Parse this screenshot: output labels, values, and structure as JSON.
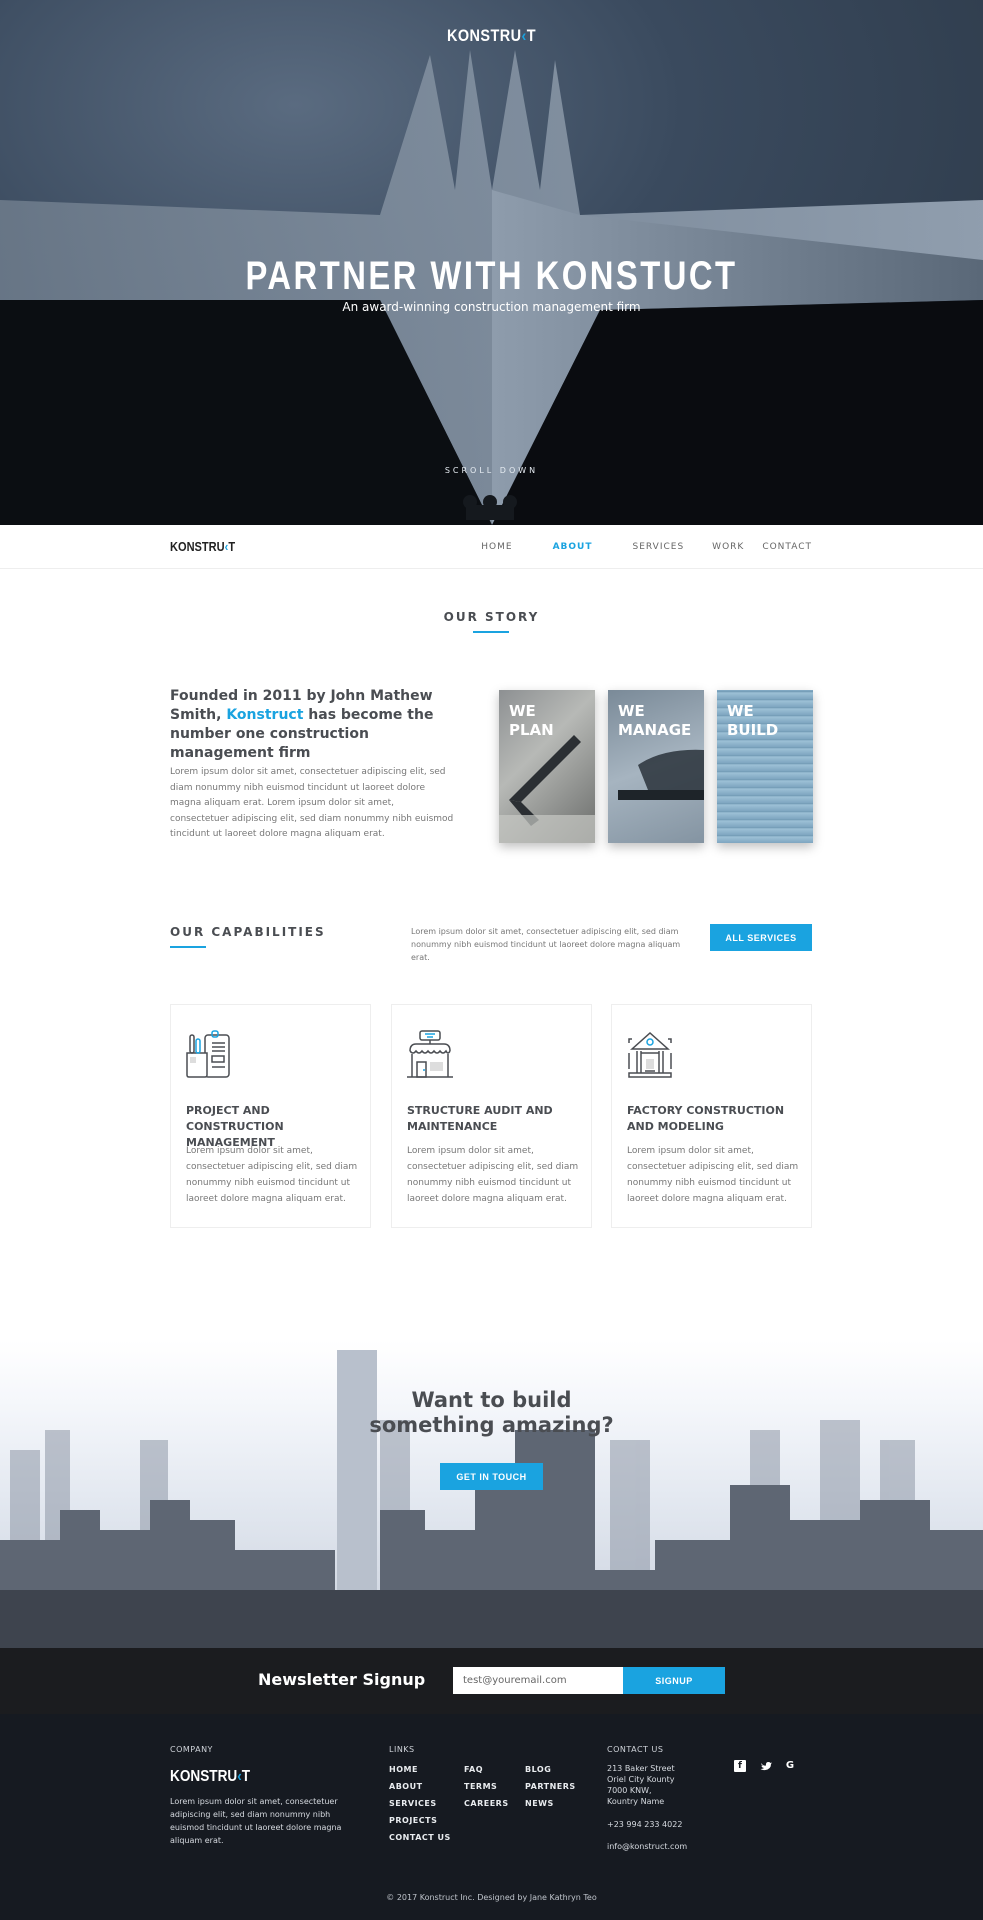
{
  "brand": {
    "logo_prefix": "KONSTRU",
    "logo_accent": "‹",
    "logo_suffix": "T",
    "accent_color": "#1aa3e0"
  },
  "hero": {
    "title": "PARTNER WITH KONSTUCT",
    "subtitle": "An award-winning construction management firm",
    "scroll_label": "SCROLL DOWN"
  },
  "nav": {
    "items": [
      {
        "label": "HOME",
        "active": false
      },
      {
        "label": "ABOUT",
        "active": true
      },
      {
        "label": "SERVICES",
        "active": false
      },
      {
        "label": "WORK",
        "active": false
      },
      {
        "label": "CONTACT",
        "active": false
      }
    ]
  },
  "story": {
    "section_title": "OUR STORY",
    "heading_part1": "Founded in 2011 by John Mathew Smith, ",
    "heading_highlight": "Konstruct",
    "heading_part2": " has become the number one construction management firm",
    "body": "Lorem ipsum dolor sit amet, consectetuer adipiscing elit, sed diam nonummy nibh euismod tincidunt ut laoreet dolore magna aliquam erat. Lorem ipsum dolor sit amet, consectetuer adipiscing elit, sed diam nonummy nibh euismod tincidunt ut laoreet dolore magna aliquam erat.",
    "tiles": [
      {
        "line1": "WE",
        "line2": "PLAN"
      },
      {
        "line1": "WE",
        "line2": "MANAGE"
      },
      {
        "line1": "WE",
        "line2": "BUILD"
      }
    ]
  },
  "capabilities": {
    "section_title": "OUR CAPABILITIES",
    "description": "Lorem ipsum dolor sit amet, consectetuer adipiscing elit, sed diam nonummy nibh euismod tincidunt ut laoreet dolore magna aliquam erat.",
    "button_label": "ALL SERVICES",
    "cards": [
      {
        "icon": "clipboard-pencils-icon",
        "title": "PROJECT AND CONSTRUCTION MANAGEMENT",
        "body": "Lorem ipsum dolor sit amet, consectetuer adipiscing elit, sed diam nonummy nibh euismod tincidunt ut laoreet dolore magna aliquam erat."
      },
      {
        "icon": "storefront-icon",
        "title": "STRUCTURE AUDIT AND MAINTENANCE",
        "body": "Lorem ipsum dolor sit amet, consectetuer adipiscing elit, sed diam nonummy nibh euismod tincidunt ut laoreet dolore magna aliquam erat."
      },
      {
        "icon": "bank-building-icon",
        "title": "FACTORY CONSTRUCTION AND MODELING",
        "body": "Lorem ipsum dolor sit amet, consectetuer adipiscing elit, sed diam nonummy nibh euismod tincidunt ut laoreet dolore magna aliquam erat."
      }
    ]
  },
  "cta": {
    "title_line1": "Want to build",
    "title_line2": "something amazing?",
    "button_label": "GET IN TOUCH"
  },
  "newsletter": {
    "label": "Newsletter Signup",
    "input_value": "test@youremail.com",
    "button_label": "SIGNUP"
  },
  "footer": {
    "company_heading": "COMPANY",
    "company_text": "Lorem ipsum dolor sit amet, consectetuer adipiscing elit, sed diam nonummy nibh euismod tincidunt ut laoreet dolore magna aliquam erat.",
    "links_heading": "LINKS",
    "links_col1": [
      "HOME",
      "ABOUT",
      "SERVICES",
      "PROJECTS",
      "CONTACT US"
    ],
    "links_col2": [
      "FAQ",
      "TERMS",
      "CAREERS"
    ],
    "links_col3": [
      "BLOG",
      "PARTNERS",
      "NEWS"
    ],
    "contact_heading": "CONTACT US",
    "address": [
      "213 Baker Street",
      "Oriel City Kounty",
      "7000 KNW,",
      "Kountry Name"
    ],
    "phone": "+23 994 233 4022",
    "email": "info@konstruct.com",
    "social": [
      {
        "name": "facebook-icon",
        "glyph": "f"
      },
      {
        "name": "twitter-icon",
        "glyph": "t"
      },
      {
        "name": "google-icon",
        "glyph": "G"
      }
    ],
    "copyright": "© 2017 Konstruct Inc. Designed by Jane Kathryn Teo"
  }
}
